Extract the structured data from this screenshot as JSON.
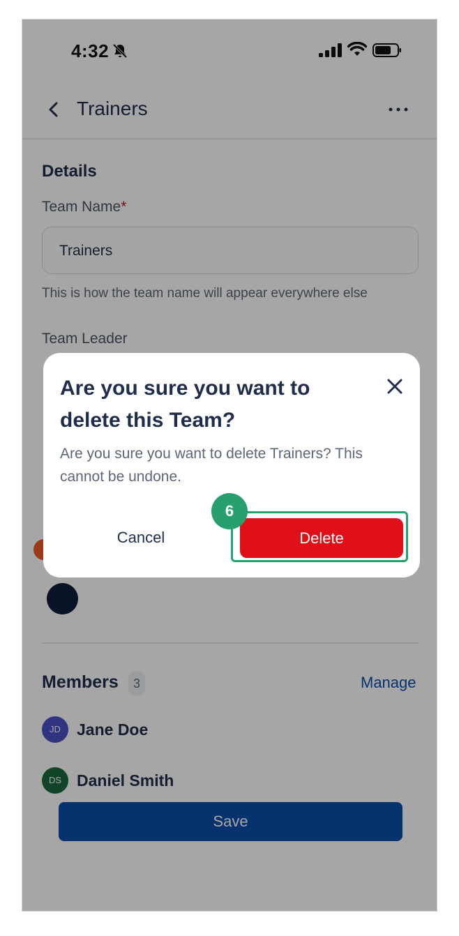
{
  "status_bar": {
    "time": "4:32"
  },
  "header": {
    "title": "Trainers"
  },
  "details": {
    "section_title": "Details",
    "team_name_label": "Team Name",
    "required_mark": "*",
    "team_name_value": "Trainers",
    "helper_text": "This is how the team name will appear everywhere else",
    "team_leader_label": "Team Leader"
  },
  "members": {
    "title": "Members",
    "count": "3",
    "manage_label": "Manage",
    "list": [
      {
        "initials": "JD",
        "name": "Jane Doe",
        "color": "#4a4fc4"
      },
      {
        "initials": "DS",
        "name": "Daniel Smith",
        "color": "#1c6b3e"
      }
    ]
  },
  "save_label": "Save",
  "modal": {
    "title": "Are you sure you want to delete this Team?",
    "body": "Are you sure you want to delete Trainers? This cannot be undone.",
    "cancel_label": "Cancel",
    "delete_label": "Delete",
    "step_number": "6"
  },
  "colors": {
    "primary": "#0a4ea8",
    "danger": "#e01019",
    "highlight": "#27a06d",
    "text_dark": "#1f2d4a",
    "team_color_selected": "#0f1e3d"
  },
  "icons": [
    "bell-slash-icon",
    "signal-icon",
    "wifi-icon",
    "battery-icon",
    "back-chevron-icon",
    "more-icon",
    "close-icon"
  ]
}
